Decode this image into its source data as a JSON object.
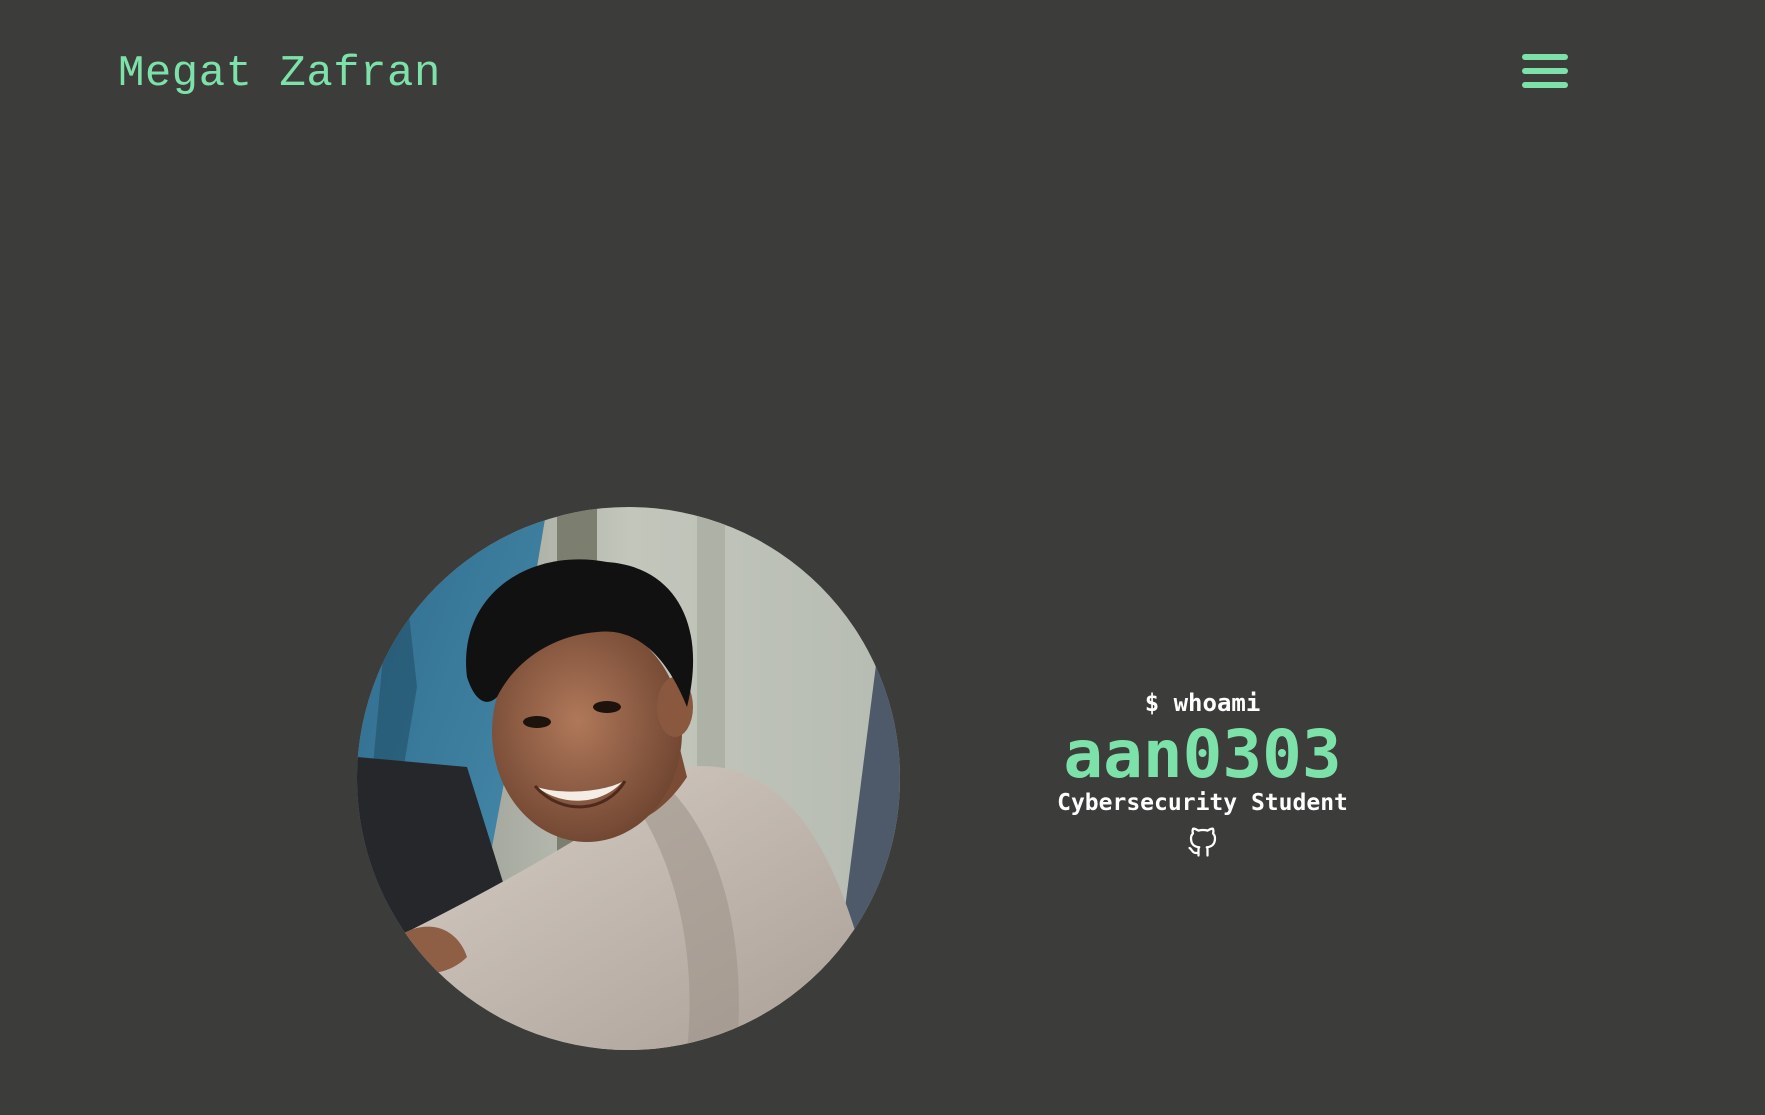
{
  "header": {
    "site_title": "Megat Zafran",
    "menu_icon": "hamburger-menu-icon"
  },
  "hero": {
    "avatar_description_icon": "profile-photo",
    "prompt": "$ whoami",
    "handle": "aan0303",
    "role": "Cybersecurity Student",
    "social_icon": "github-icon"
  },
  "colors": {
    "background": "#3c3c3b",
    "accent": "#7de2a9",
    "text": "#ffffff"
  }
}
